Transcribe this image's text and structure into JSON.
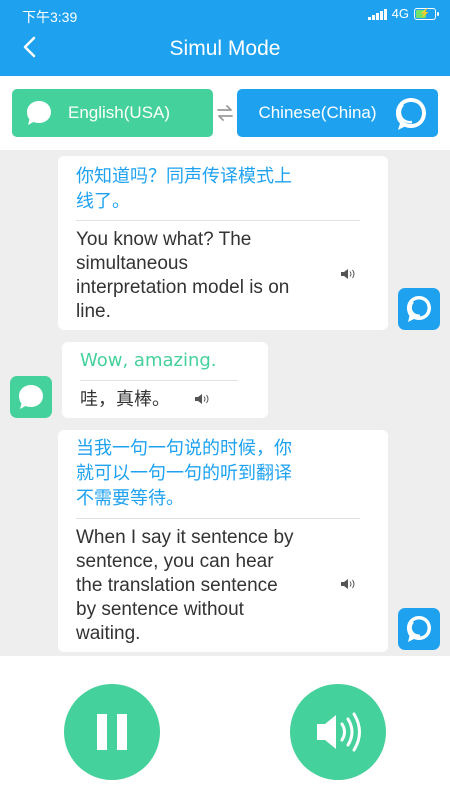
{
  "status": {
    "time": "下午3:39",
    "network": "4G"
  },
  "header": {
    "title": "Simul Mode"
  },
  "languages": {
    "source": "English(USA)",
    "target": "Chinese(China)"
  },
  "messages": [
    {
      "side": "right",
      "source": [
        "你知道吗？同声传译模式上",
        "线了。"
      ],
      "translation": [
        "You know what? The",
        "simultaneous",
        "interpretation model is on",
        "line."
      ]
    },
    {
      "side": "left",
      "source": [
        "Wow, amazing."
      ],
      "translation": [
        "哇，真棒。"
      ]
    },
    {
      "side": "right",
      "source": [
        "当我一句一句说的时候，你",
        "就可以一句一句的听到翻译",
        "不需要等待。"
      ],
      "translation": [
        "When I say it sentence by",
        "sentence, you can hear",
        "the translation sentence",
        "by sentence without",
        "waiting."
      ]
    }
  ],
  "colors": {
    "blue": "#1ea2f0",
    "green": "#44d19b",
    "chat_bg": "#eeeeee"
  },
  "icons": [
    "back-arrow-icon",
    "chat-bubble-icon",
    "swap-arrows-icon",
    "speaker-icon",
    "pause-icon",
    "volume-icon"
  ]
}
